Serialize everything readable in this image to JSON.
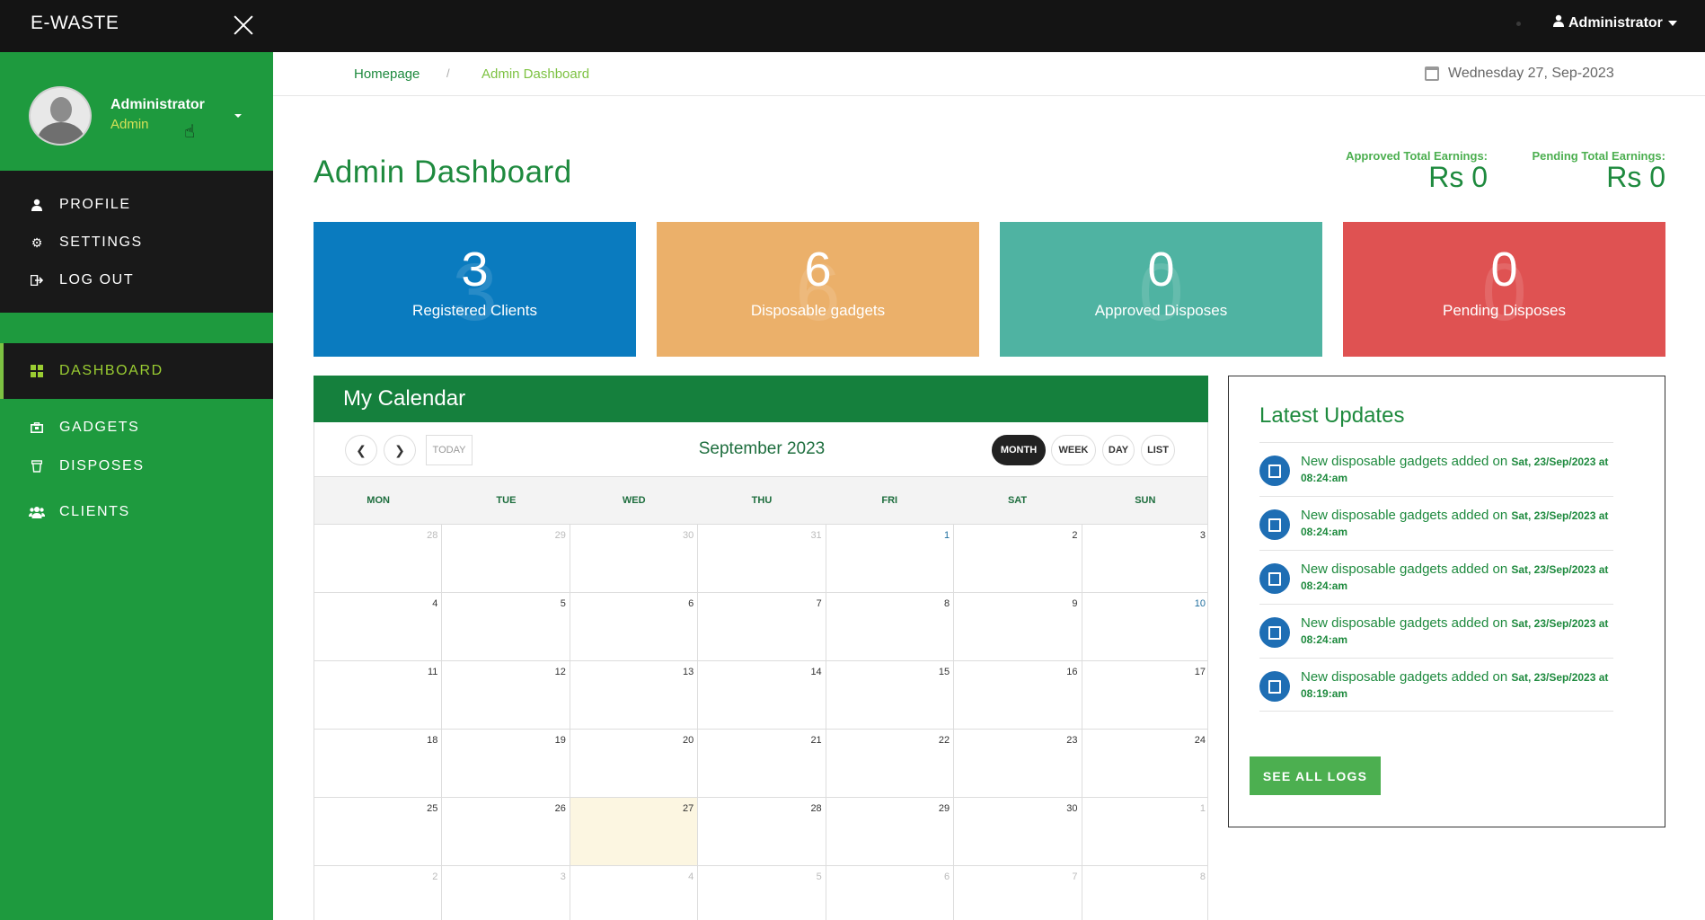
{
  "app": {
    "brand": "E-WASTE"
  },
  "topbar": {
    "user_label": "Administrator"
  },
  "sidebar": {
    "profile": {
      "name": "Administrator",
      "role": "Admin"
    },
    "account_menu": [
      {
        "label": "PROFILE",
        "icon": "user-icon"
      },
      {
        "label": "SETTINGS",
        "icon": "gear-icon"
      },
      {
        "label": "LOG OUT",
        "icon": "logout-icon"
      }
    ],
    "active": {
      "label": "DASHBOARD",
      "icon": "grid-icon"
    },
    "nav": [
      {
        "label": "GADGETS",
        "icon": "briefcase-icon"
      },
      {
        "label": "DISPOSES",
        "icon": "trash-icon"
      },
      {
        "label": "CLIENTS",
        "icon": "users-icon"
      }
    ]
  },
  "breadcrumb": {
    "home": "Homepage",
    "separator": "/",
    "current": "Admin Dashboard"
  },
  "date_display": "Wednesday 27, Sep-2023",
  "main": {
    "title": "Admin Dashboard",
    "earnings": [
      {
        "label": "Approved Total Earnings:",
        "value": "Rs 0"
      },
      {
        "label": "Pending Total Earnings:",
        "value": "Rs 0"
      }
    ],
    "stats": [
      {
        "value": "3",
        "label": "Registered Clients",
        "color": "#0a7bbf"
      },
      {
        "value": "6",
        "label": "Disposable gadgets",
        "color": "#ebb06a"
      },
      {
        "value": "0",
        "label": "Approved Disposes",
        "color": "#4fb3a2"
      },
      {
        "value": "0",
        "label": "Pending Disposes",
        "color": "#df5252"
      }
    ]
  },
  "calendar": {
    "header": "My Calendar",
    "today_label": "TODAY",
    "month_label": "September 2023",
    "views": [
      "MONTH",
      "WEEK",
      "DAY",
      "LIST"
    ],
    "active_view": "MONTH",
    "weekdays": [
      "MON",
      "TUE",
      "WED",
      "THU",
      "FRI",
      "SAT",
      "SUN"
    ],
    "weeks": [
      [
        "28",
        "29",
        "30",
        "31",
        "1",
        "2",
        "3"
      ],
      [
        "4",
        "5",
        "6",
        "7",
        "8",
        "9",
        "10"
      ],
      [
        "11",
        "12",
        "13",
        "14",
        "15",
        "16",
        "17"
      ],
      [
        "18",
        "19",
        "20",
        "21",
        "22",
        "23",
        "24"
      ],
      [
        "25",
        "26",
        "27",
        "28",
        "29",
        "30",
        "1"
      ],
      [
        "2",
        "3",
        "4",
        "5",
        "6",
        "7",
        "8"
      ]
    ],
    "today": "27"
  },
  "updates": {
    "title": "Latest Updates",
    "items": [
      {
        "text": "New disposable gadgets added on ",
        "when": "Sat, 23/Sep/2023 at 08:24:am"
      },
      {
        "text": "New disposable gadgets added on ",
        "when": "Sat, 23/Sep/2023 at 08:24:am"
      },
      {
        "text": "New disposable gadgets added on ",
        "when": "Sat, 23/Sep/2023 at 08:24:am"
      },
      {
        "text": "New disposable gadgets added on ",
        "when": "Sat, 23/Sep/2023 at 08:24:am"
      },
      {
        "text": "New disposable gadgets added on ",
        "when": "Sat, 23/Sep/2023 at 08:19:am"
      }
    ],
    "button": "SEE ALL LOGS"
  }
}
